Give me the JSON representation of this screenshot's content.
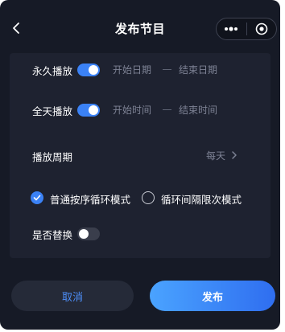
{
  "header": {
    "title": "发布节目"
  },
  "form": {
    "permanent_play": {
      "label": "永久播放",
      "enabled": true,
      "start_placeholder": "开始日期",
      "end_placeholder": "结束日期"
    },
    "all_day_play": {
      "label": "全天播放",
      "enabled": true,
      "start_placeholder": "开始时间",
      "end_placeholder": "结束时间"
    },
    "play_cycle": {
      "label": "播放周期",
      "value": "每天"
    },
    "play_mode": {
      "options": [
        {
          "label": "普通按序循环模式",
          "selected": true
        },
        {
          "label": "循环间隔限次模式",
          "selected": false
        }
      ]
    },
    "replace": {
      "label": "是否替换",
      "enabled": false
    }
  },
  "footer": {
    "cancel_label": "取消",
    "publish_label": "发布"
  },
  "colors": {
    "background": "#161a26",
    "card": "#1e2230",
    "accent": "#3b82f6",
    "muted_text": "#7d8294"
  }
}
